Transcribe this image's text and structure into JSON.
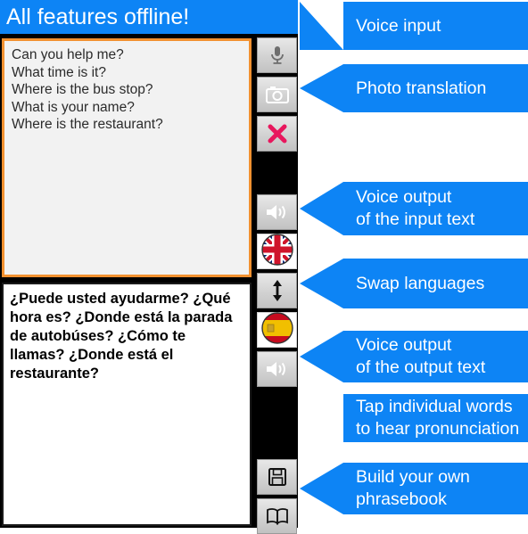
{
  "app": {
    "title": "All features offline!",
    "accent_blue": "#0d84f5",
    "input_border_orange": "#f29130",
    "close_icon_color": "#e8175d",
    "rail_background": "#000000"
  },
  "input_panel": {
    "name": "source-text-area",
    "lines": [
      "Can you help me?",
      "What time is it?",
      "Where is the bus stop?",
      "What is your name?",
      "Where is the restaurant?"
    ]
  },
  "output_panel": {
    "name": "translated-text-area",
    "text": "¿Puede usted ayudarme? ¿Qué hora es? ¿Donde está la parada de autobúses? ¿Cómo te llamas? ¿Donde está el restaurante?"
  },
  "buttons": [
    {
      "icon": "microphone-icon",
      "label": "Voice input"
    },
    {
      "icon": "camera-icon",
      "label": "Photo translation"
    },
    {
      "icon": "close-x-icon",
      "label": "Clear text"
    },
    {
      "icon": "speaker-icon",
      "label": "Voice output of the input text"
    },
    {
      "icon": "uk-flag-icon",
      "label": "Source language: English"
    },
    {
      "icon": "swap-vertical-icon",
      "label": "Swap languages"
    },
    {
      "icon": "spain-flag-icon",
      "label": "Target language: Spanish"
    },
    {
      "icon": "speaker-icon",
      "label": "Voice output of the output text"
    },
    {
      "icon": "floppy-disk-icon",
      "label": "Save phrase"
    },
    {
      "icon": "book-icon",
      "label": "Phrasebook"
    }
  ],
  "callouts": [
    {
      "lines": [
        "Voice input"
      ],
      "pointer": true
    },
    {
      "lines": [
        "Photo translation"
      ],
      "pointer": true
    },
    {
      "lines": [
        "Voice output",
        "of the input text"
      ],
      "pointer": true
    },
    {
      "lines": [
        "Swap languages"
      ],
      "pointer": true
    },
    {
      "lines": [
        "Voice output",
        "of the output text"
      ],
      "pointer": true
    },
    {
      "lines": [
        "Tap individual words",
        "to hear pronunciation"
      ],
      "pointer": false
    },
    {
      "lines": [
        "Build your own",
        "phrasebook"
      ],
      "pointer": true
    }
  ]
}
